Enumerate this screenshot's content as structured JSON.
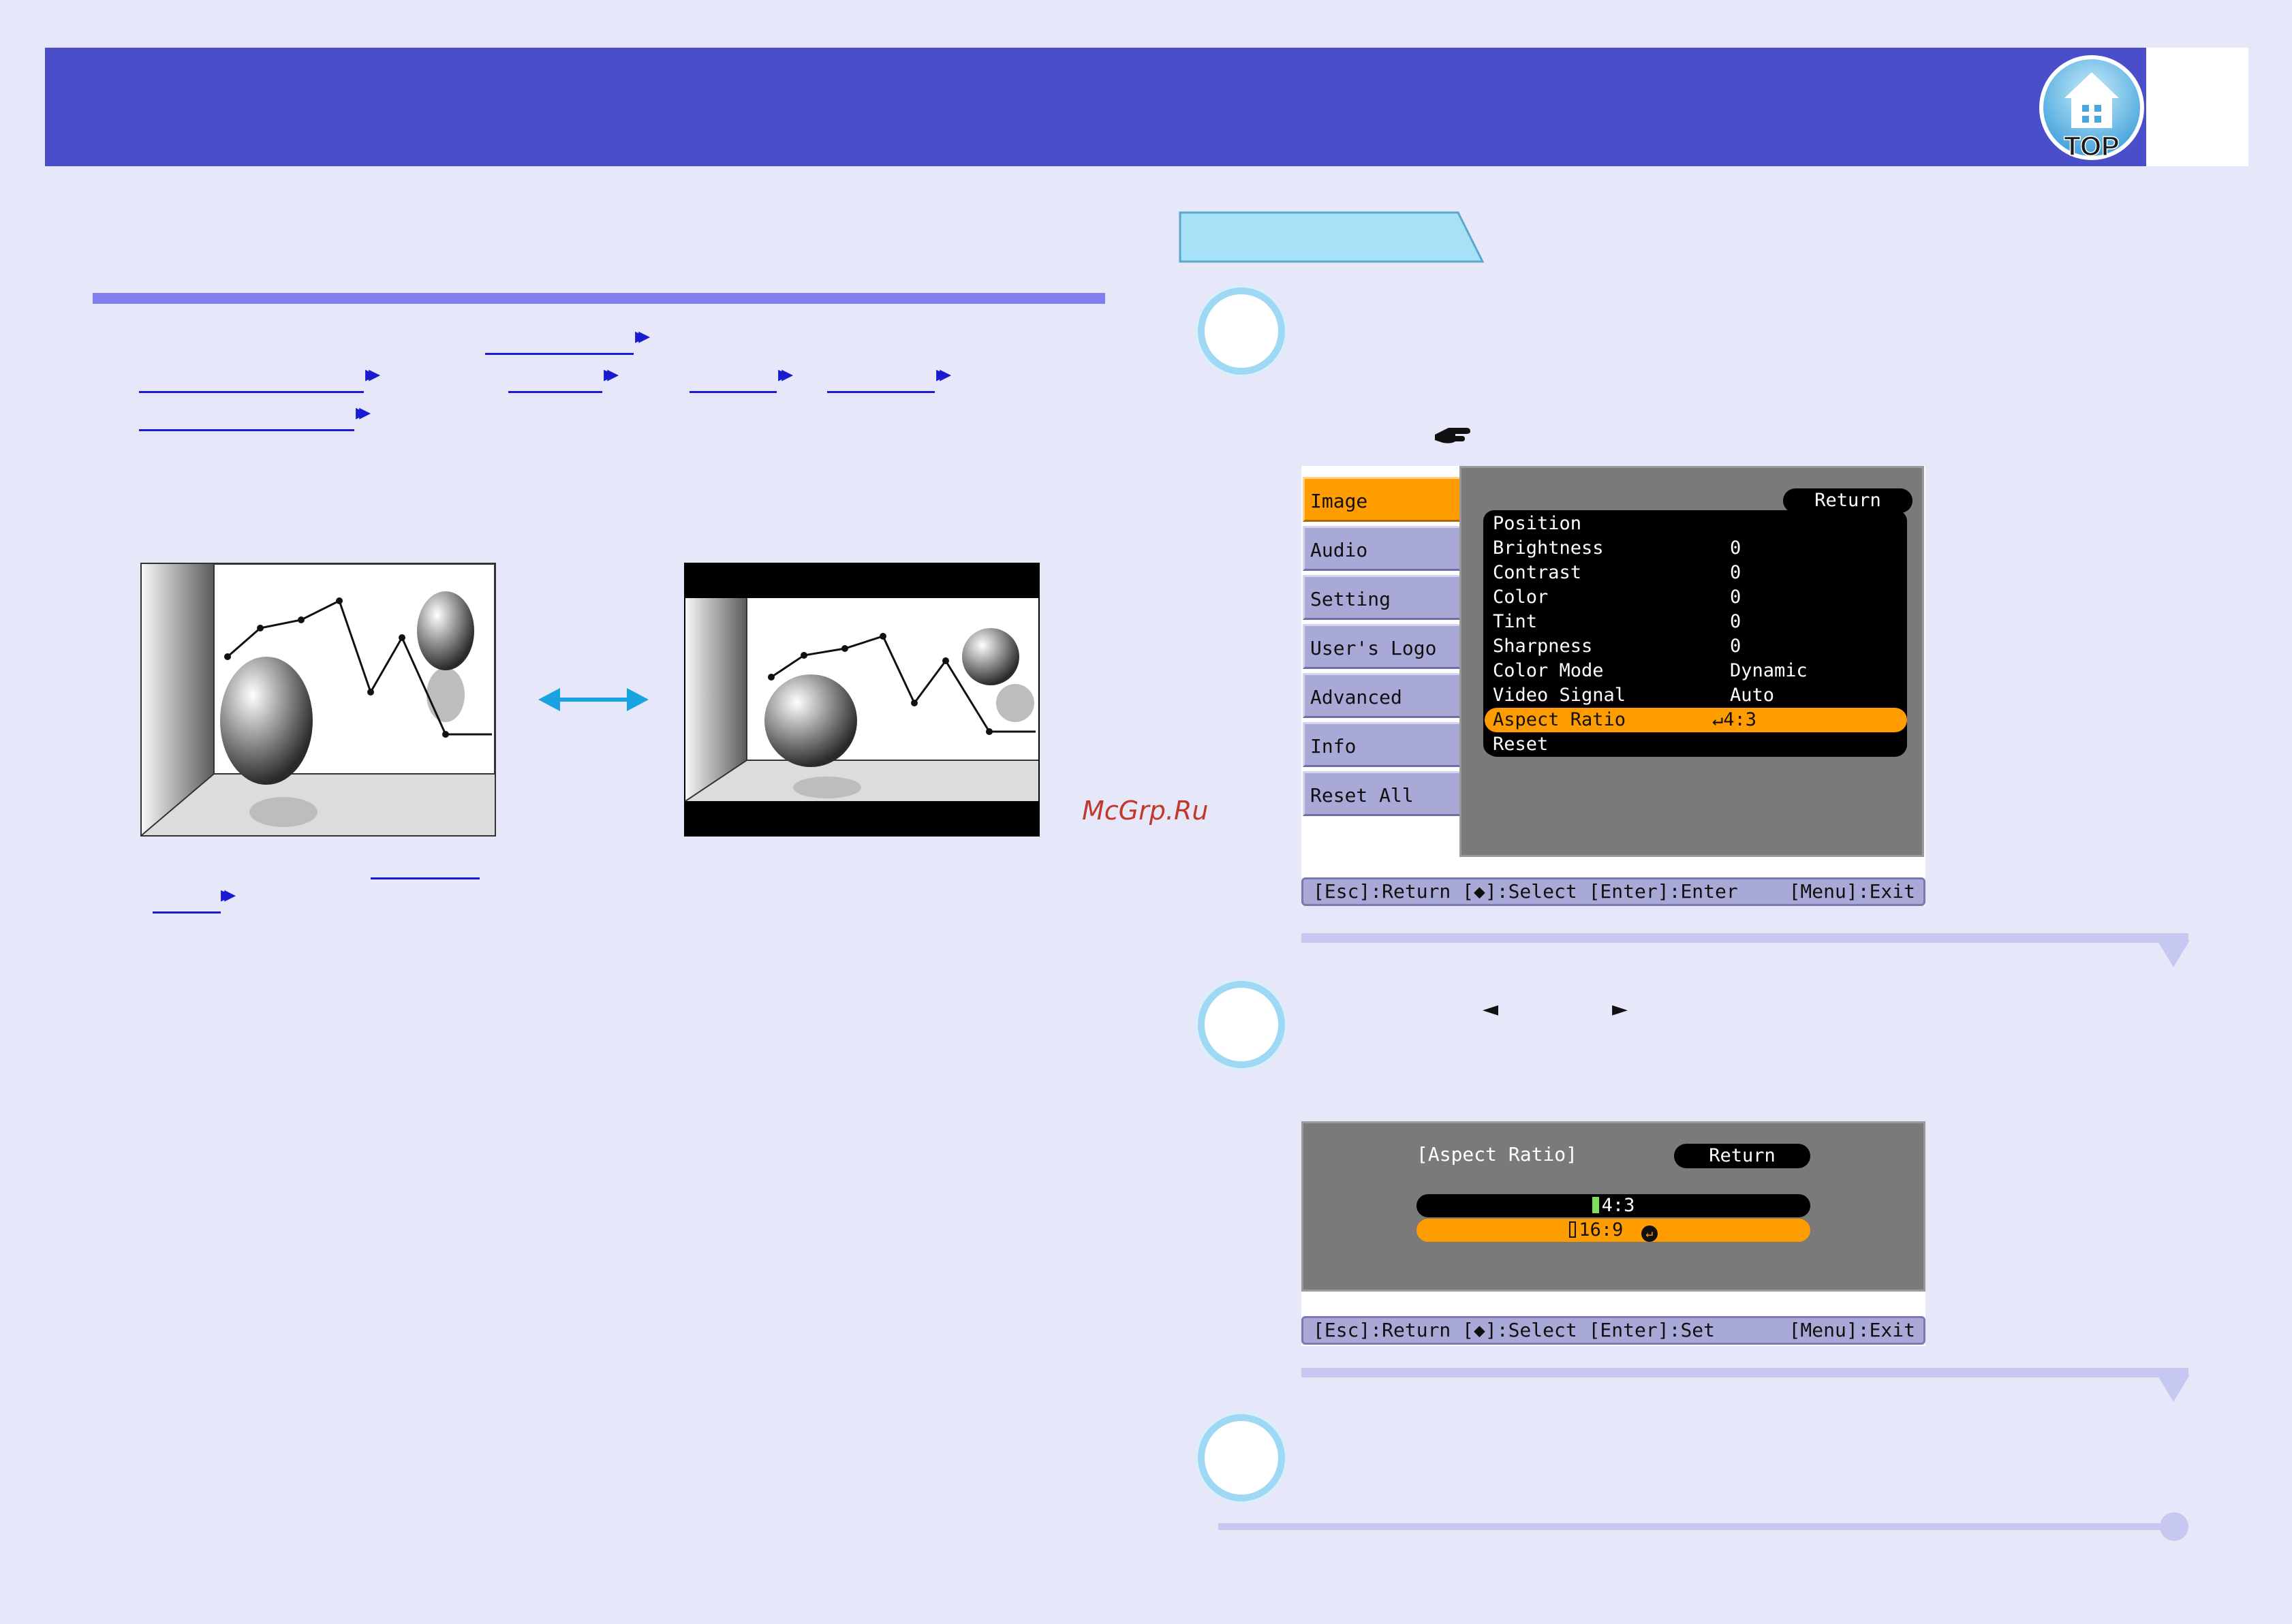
{
  "header": {
    "top_badge_label": "TOP"
  },
  "watermark": "McGrp.Ru",
  "menu_screen": {
    "tabs": [
      "Image",
      "Audio",
      "Setting",
      "User's Logo",
      "Advanced",
      "Info",
      "Reset All"
    ],
    "active_tab": "Image",
    "return_label": "Return",
    "items": [
      {
        "label": "Position",
        "value": ""
      },
      {
        "label": "Brightness",
        "value": "0"
      },
      {
        "label": "Contrast",
        "value": "0"
      },
      {
        "label": "Color",
        "value": "0"
      },
      {
        "label": "Tint",
        "value": "0"
      },
      {
        "label": "Sharpness",
        "value": "0"
      },
      {
        "label": "Color Mode",
        "value": "Dynamic"
      },
      {
        "label": "Video Signal",
        "value": "Auto"
      },
      {
        "label": "Aspect Ratio",
        "value": "↵4:3"
      },
      {
        "label": "Reset",
        "value": ""
      }
    ],
    "help_left": "[Esc]:Return [◆]:Select [Enter]:Enter",
    "help_right": "[Menu]:Exit"
  },
  "step2_arrows": {
    "left": "◄",
    "right": "►"
  },
  "aspect_screen": {
    "title": "[Aspect Ratio]",
    "return_label": "Return",
    "options": [
      {
        "label": "4:3",
        "selected": false
      },
      {
        "label": "16:9",
        "selected": true
      }
    ],
    "help_left": "[Esc]:Return [◆]:Select [Enter]:Set",
    "help_right": "[Menu]:Exit"
  },
  "colors": {
    "header": "#4b4ec9",
    "accent_orange": "#ff9c00",
    "link_blue": "#1a1ad0",
    "step_ring": "#9ed8f4",
    "separator": "#c6c8f2"
  }
}
